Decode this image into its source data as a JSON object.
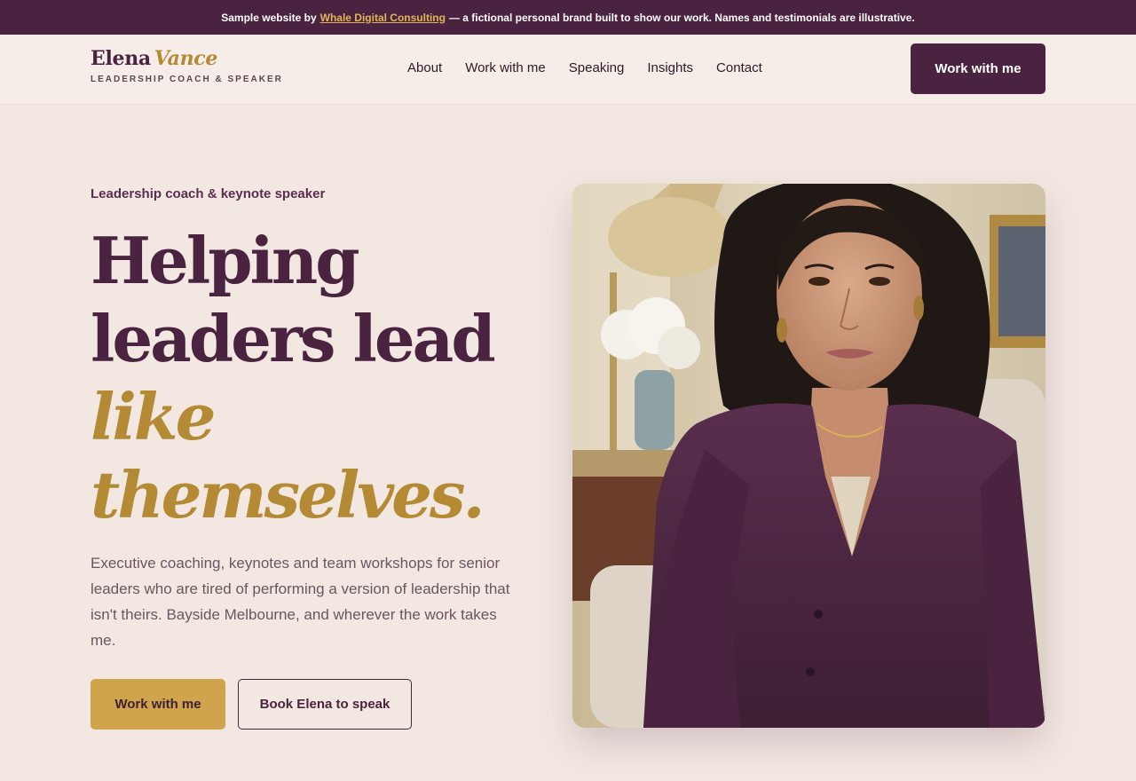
{
  "banner": {
    "prefix": "Sample website by",
    "link": "Whale Digital Consulting",
    "suffix": "— a fictional personal brand built to show our work. Names and testimonials are illustrative."
  },
  "header": {
    "logo_first": "Elena",
    "logo_second": "Vance",
    "tagline": "LEADERSHIP COACH & SPEAKER",
    "nav": [
      "About",
      "Work with me",
      "Speaking",
      "Insights",
      "Contact"
    ],
    "cta": "Work with me"
  },
  "hero": {
    "eyebrow": "Leadership coach & keynote speaker",
    "headline_line1": "Helping",
    "headline_line2": "leaders lead",
    "headline_line3": "like",
    "headline_line4": "themselves.",
    "lede": "Executive coaching, keynotes and team workshops for senior leaders who are tired of performing a version of leadership that isn't theirs. Bayside Melbourne, and wherever the work takes me.",
    "primary_button": "Work with me",
    "secondary_button": "Book Elena to speak"
  },
  "colors": {
    "brand_plum": "#4a2340",
    "brand_gold": "#b48a35",
    "button_gold": "#d0a44c",
    "background": "#f3e8e1"
  }
}
